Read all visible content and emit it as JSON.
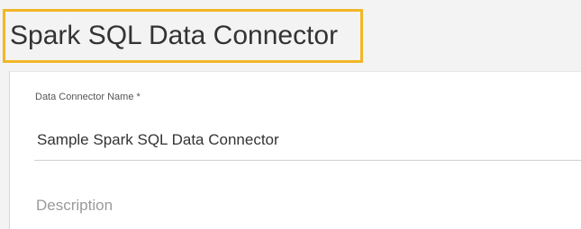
{
  "page": {
    "title": "Spark SQL Data Connector"
  },
  "form": {
    "name_label": "Data Connector Name *",
    "name_value": "Sample Spark SQL Data Connector",
    "description_placeholder": "Description"
  },
  "colors": {
    "highlight_border": "#f2b626",
    "background": "#f3f3f3",
    "panel": "#ffffff"
  }
}
